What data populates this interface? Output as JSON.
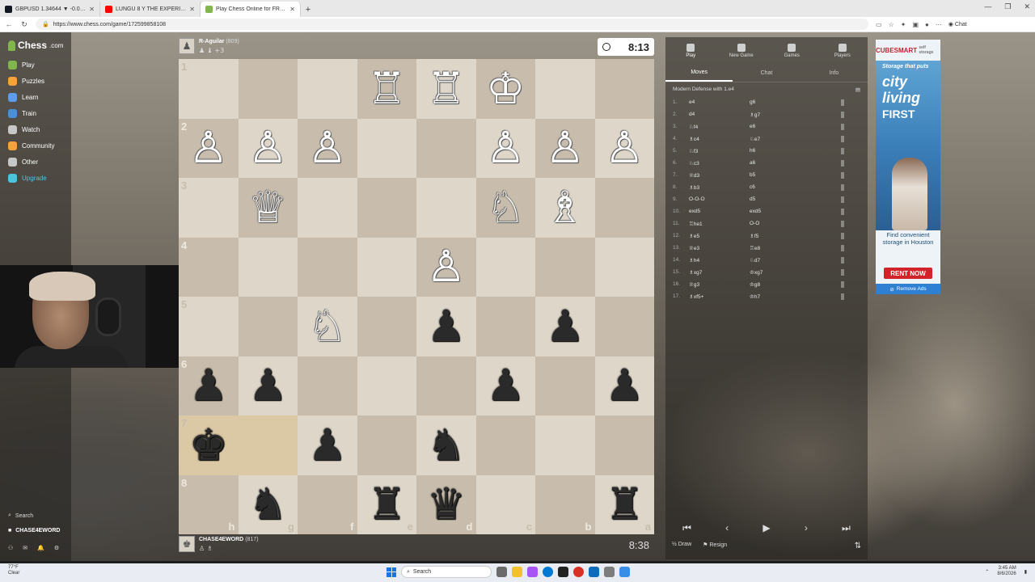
{
  "browser": {
    "tabs": [
      {
        "title": "GBPUSD 1.34644 ▼ -0.03% $100k",
        "color": "#131722",
        "active": false
      },
      {
        "title": "LUNGU 8 Y THE EXPERIENCE",
        "color": "#ff0000",
        "active": false
      },
      {
        "title": "Play Chess Online for FREE - 2 Player",
        "color": "#81b64c",
        "active": true
      }
    ],
    "url": "https://www.chess.com/game/172599858108",
    "chat_label": "Chat"
  },
  "nav": {
    "logo": "Chess",
    "logo_domain": ".com",
    "items": [
      {
        "label": "Play",
        "icon": "play-icon",
        "color": "#81b64c"
      },
      {
        "label": "Puzzles",
        "icon": "puzzle-icon",
        "color": "#f7a33b"
      },
      {
        "label": "Learn",
        "icon": "learn-icon",
        "color": "#5d9cec"
      },
      {
        "label": "Train",
        "icon": "train-icon",
        "color": "#4a90d9"
      },
      {
        "label": "Watch",
        "icon": "watch-icon",
        "color": "#c7c7c7"
      },
      {
        "label": "Community",
        "icon": "community-icon",
        "color": "#f4a340"
      },
      {
        "label": "Other",
        "icon": "more-icon",
        "color": "#c7c7c7"
      },
      {
        "label": "Upgrade",
        "icon": "diamond-icon",
        "color": "#4ec3e0"
      }
    ],
    "search_placeholder": "Search",
    "username": "CHASE4EWORD"
  },
  "game": {
    "top_player": {
      "name": "R-Aguilar",
      "rating": "(809)",
      "captured": "♟ ♝ +3",
      "clock": "8:13"
    },
    "bottom_player": {
      "name": "CHASE4EWORD",
      "rating": "(817)",
      "captured": "♙ ♗",
      "clock": "8:38"
    },
    "ranks": [
      "1",
      "2",
      "3",
      "4",
      "5",
      "6",
      "7",
      "8"
    ],
    "files": [
      "h",
      "g",
      "f",
      "e",
      "d",
      "c",
      "b",
      "a"
    ],
    "board": [
      [
        "",
        "",
        "",
        "wR",
        "wR",
        "wK",
        "",
        ""
      ],
      [
        "wP",
        "wP",
        "wP",
        "",
        "",
        "wP",
        "wP",
        "wP"
      ],
      [
        "",
        "wQ",
        "",
        "",
        "",
        "wN",
        "wB",
        ""
      ],
      [
        "",
        "",
        "",
        "",
        "wP",
        "",
        "",
        ""
      ],
      [
        "",
        "",
        "wN",
        "",
        "bP",
        "",
        "bP",
        ""
      ],
      [
        "bP",
        "bP",
        "",
        "",
        "",
        "bP",
        "",
        "bP"
      ],
      [
        "bK",
        "",
        "bP",
        "",
        "bN",
        "",
        "",
        ""
      ],
      [
        "",
        "bN",
        "",
        "bR",
        "bQ",
        "",
        "",
        "bR"
      ]
    ]
  },
  "panel": {
    "top_buttons": [
      {
        "label": "Play",
        "icon": "play-icon"
      },
      {
        "label": "New Game",
        "icon": "new-game-icon"
      },
      {
        "label": "Games",
        "icon": "games-icon"
      },
      {
        "label": "Players",
        "icon": "players-icon"
      }
    ],
    "tabs": [
      "Moves",
      "Chat",
      "Info"
    ],
    "opening": "Modern Defense with 1.e4",
    "moves": [
      {
        "n": "1.",
        "w": "e4",
        "b": "g6"
      },
      {
        "n": "2.",
        "w": "d4",
        "b": "♗g7"
      },
      {
        "n": "3.",
        "w": "♘f4",
        "b": "e6"
      },
      {
        "n": "4.",
        "w": "♗c4",
        "b": "♘e7"
      },
      {
        "n": "5.",
        "w": "♘f3",
        "b": "h6"
      },
      {
        "n": "6.",
        "w": "♘c3",
        "b": "a6"
      },
      {
        "n": "7.",
        "w": "♕d3",
        "b": "b5"
      },
      {
        "n": "8.",
        "w": "♗b3",
        "b": "c6"
      },
      {
        "n": "9.",
        "w": "O-O-O",
        "b": "d5"
      },
      {
        "n": "10.",
        "w": "exd5",
        "b": "exd5"
      },
      {
        "n": "11.",
        "w": "♖he1",
        "b": "O-O"
      },
      {
        "n": "12.",
        "w": "♗e5",
        "b": "♗f5"
      },
      {
        "n": "13.",
        "w": "♕e3",
        "b": "♖e8"
      },
      {
        "n": "14.",
        "w": "♗h4",
        "b": "♘d7"
      },
      {
        "n": "15.",
        "w": "♗xg7",
        "b": "♔xg7"
      },
      {
        "n": "16.",
        "w": "♕g3",
        "b": "♔g8"
      },
      {
        "n": "17.",
        "w": "♗xf5+",
        "b": "♔h7"
      }
    ],
    "draw_label": "Draw",
    "resign_label": "Resign"
  },
  "ad": {
    "brand": "CUBESMART",
    "brand_tag": "self storage",
    "line1": "Storage that puts",
    "line2": "city",
    "line3": "living",
    "line4": "FIRST",
    "sub": "Find convenient storage in Houston",
    "cta": "RENT NOW",
    "remove": "Remove Ads"
  },
  "taskbar": {
    "temp": "77°F",
    "weather": "Clear",
    "search": "Search",
    "time": "3:45 AM",
    "date": "8/6/2026"
  }
}
